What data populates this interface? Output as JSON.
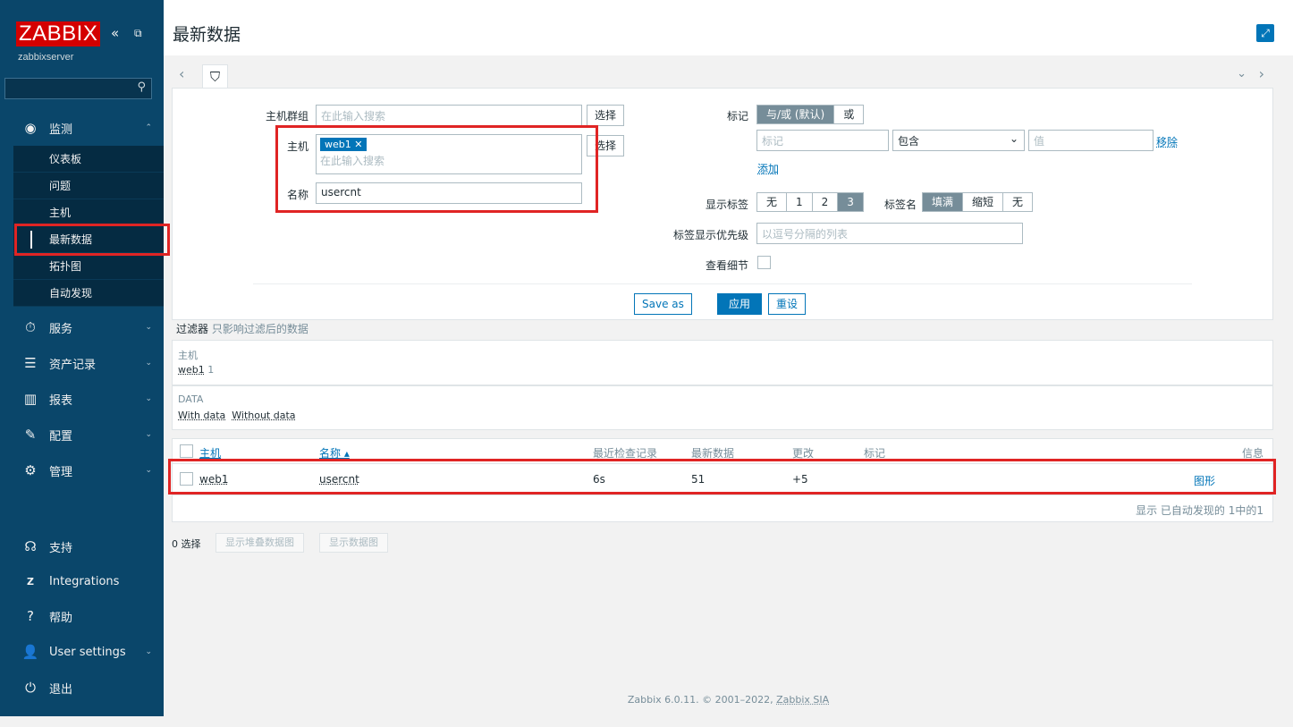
{
  "sidebar": {
    "logo": "ZABBIX",
    "collapse_icon": "«",
    "kiosk_icon": "⧉",
    "server": "zabbixserver",
    "search_icon": "⚲",
    "monitor": {
      "label": "监测",
      "icon": "eye-icon"
    },
    "monitor_sub": [
      "仪表板",
      "问题",
      "主机",
      "最新数据",
      "拓扑图",
      "自动发现"
    ],
    "services": "服务",
    "inventory": "资产记录",
    "reports": "报表",
    "config": "配置",
    "admin": "管理",
    "support": "支持",
    "integrations": "Integrations",
    "help": "帮助",
    "user_settings": "User settings",
    "logout": "退出"
  },
  "header": {
    "title": "最新数据",
    "kiosk": "⤢"
  },
  "filter": {
    "hostgroup_label": "主机群组",
    "hostgroup_placeholder": "在此输入搜索",
    "select_label": "选择",
    "host_label": "主机",
    "host_chip": "web1",
    "host_placeholder": "在此输入搜索",
    "name_label": "名称",
    "name_value": "usercnt",
    "tags_label": "标记",
    "tag_mode": [
      "与/或 (默认)",
      "或"
    ],
    "tag_placeholder": "标记",
    "tag_op": "包含",
    "tag_value_placeholder": "值",
    "remove": "移除",
    "add": "添加",
    "show_tags_label": "显示标签",
    "show_tags": [
      "无",
      "1",
      "2",
      "3"
    ],
    "tag_name_label": "标签名",
    "tag_name": [
      "填满",
      "缩短",
      "无"
    ],
    "tag_priority_label": "标签显示优先级",
    "tag_priority_placeholder": "以逗号分隔的列表",
    "details_label": "查看细节",
    "save_as": "Save as",
    "apply": "应用",
    "reset": "重设"
  },
  "summary": {
    "title": "过滤器",
    "subtitle": "只影响过滤后的数据",
    "host_head": "主机",
    "host_val": "web1",
    "host_count": "1",
    "data_head": "DATA",
    "with_data": "With data",
    "without_data": "Without data"
  },
  "table": {
    "headers": {
      "host": "主机",
      "name": "名称 ▴",
      "last_check": "最近检查记录",
      "last_value": "最新数据",
      "change": "更改",
      "tags": "标记",
      "info": "信息"
    },
    "rows": [
      {
        "host": "web1",
        "name": "usercnt",
        "last_check": "6s",
        "last_value": "51",
        "change": "+5",
        "graph": "图形"
      }
    ],
    "display": "显示 已自动发现的 1中的1"
  },
  "actions": {
    "selected": "0 选择",
    "stacked": "显示堆叠数据图",
    "graph": "显示数据图"
  },
  "footer": {
    "text": "Zabbix 6.0.11. © 2001–2022,",
    "company": "Zabbix SIA"
  }
}
